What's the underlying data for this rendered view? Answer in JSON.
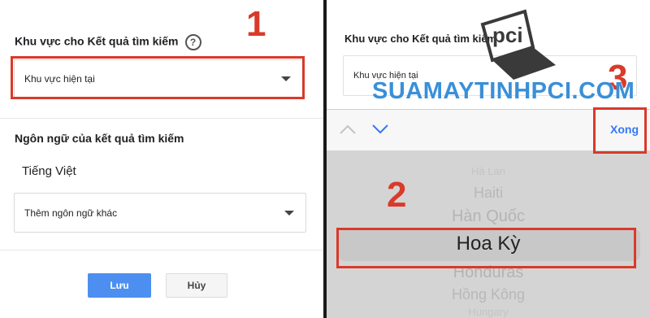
{
  "left": {
    "section1_heading": "Khu vực cho Kết quả tìm kiếm",
    "help_glyph": "?",
    "region_select_value": "Khu vực hiện tại",
    "section2_heading": "Ngôn ngữ của kết quả tìm kiếm",
    "current_language": "Tiếng Việt",
    "language_select_value": "Thêm ngôn ngữ khác",
    "save_label": "Lưu",
    "cancel_label": "Hủy",
    "step_number": "1"
  },
  "right": {
    "section1_heading": "Khu vực cho Kết quả tìm kiếm",
    "region_select_value": "Khu vực hiện tại",
    "done_label": "Xong",
    "step_number_picker": "2",
    "step_number_done": "3",
    "picker_options": [
      "Hà Lan",
      "Haiti",
      "Hàn Quốc",
      "Hoa Kỳ",
      "Honduras",
      "Hồng Kông",
      "Hungary"
    ],
    "picker_selected": "Hoa Kỳ"
  },
  "watermark": {
    "logo_text": "pci",
    "site_text": "SUAMAYTINHPCI.COM"
  },
  "colors": {
    "accent_red": "#d93a2a",
    "blue_button": "#4d8ff0",
    "ios_blue": "#3478f6"
  }
}
